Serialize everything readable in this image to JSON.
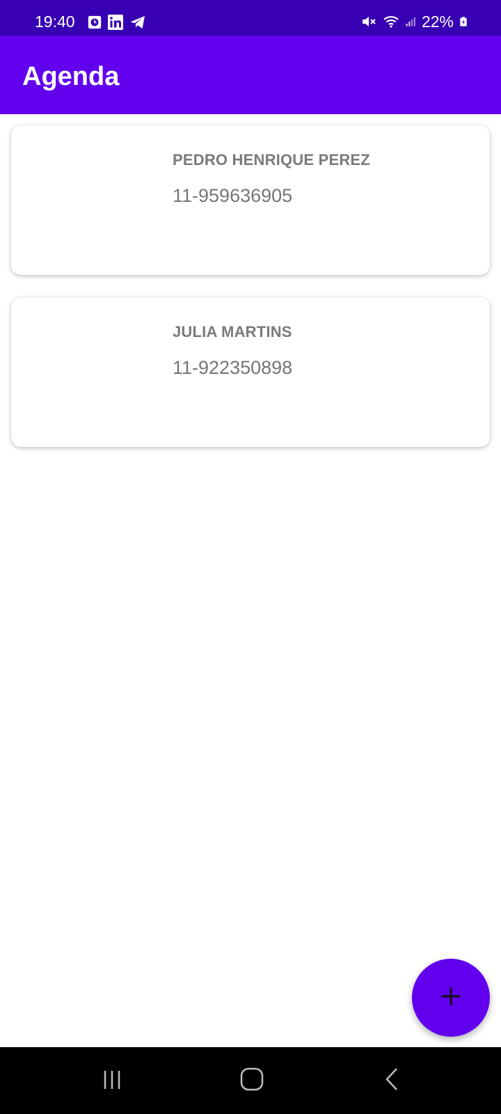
{
  "status_bar": {
    "time": "19:40",
    "battery": "22%",
    "icons": [
      "clock-notification-icon",
      "linkedin-icon",
      "telegram-icon",
      "mute-icon",
      "wifi-icon",
      "signal-icon",
      "battery-charging-icon"
    ]
  },
  "app_bar": {
    "title": "Agenda"
  },
  "contacts": [
    {
      "name": "PEDRO HENRIQUE PEREZ",
      "phone": "11-959636905"
    },
    {
      "name": "JULIA MARTINS",
      "phone": "11-922350898"
    }
  ],
  "fab": {
    "icon": "plus-icon"
  },
  "nav_bar": {
    "buttons": [
      "recent-apps-icon",
      "home-icon",
      "back-icon"
    ]
  },
  "colors": {
    "status_bar": "#3700b3",
    "primary": "#6200ee",
    "text_secondary": "#757575"
  }
}
